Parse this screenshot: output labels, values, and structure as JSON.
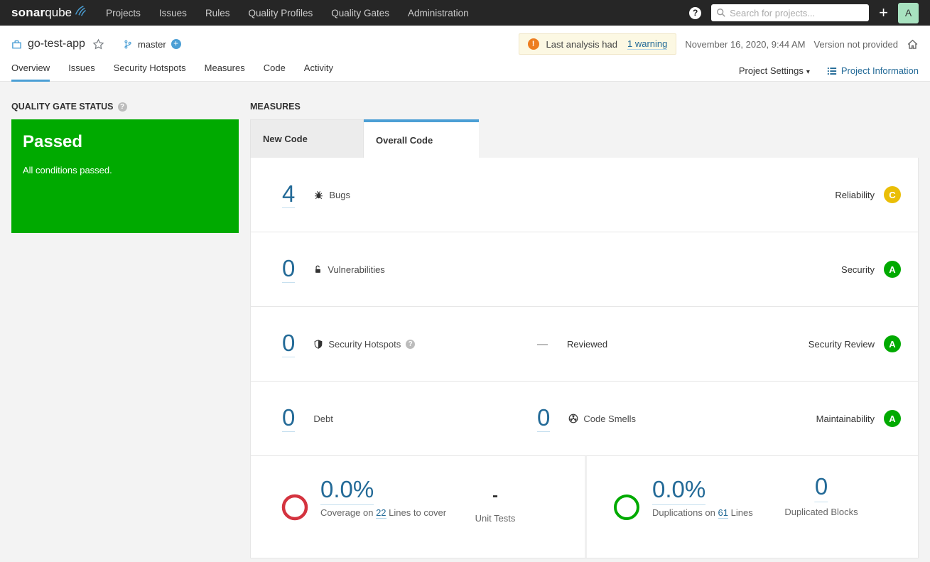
{
  "navbar": {
    "brand_bold": "sonar",
    "brand_light": "qube",
    "items": [
      "Projects",
      "Issues",
      "Rules",
      "Quality Profiles",
      "Quality Gates",
      "Administration"
    ],
    "help": "?",
    "search_placeholder": "Search for projects...",
    "plus": "+",
    "avatar_initial": "A"
  },
  "header": {
    "project_name": "go-test-app",
    "branch_name": "master",
    "branch_add": "+",
    "warning_icon": "!",
    "warning_text": "Last analysis had",
    "warning_link": "1 warning",
    "analysis_date": "November 16, 2020, 9:44 AM",
    "version_text": "Version not provided",
    "tabs": [
      "Overview",
      "Issues",
      "Security Hotspots",
      "Measures",
      "Code",
      "Activity"
    ],
    "settings_label": "Project Settings",
    "settings_caret": "▾",
    "info_label": "Project Information"
  },
  "quality_gate": {
    "title": "QUALITY GATE STATUS",
    "help": "?",
    "status": "Passed",
    "message": "All conditions passed."
  },
  "measures": {
    "title": "MEASURES",
    "tab_new": "New Code",
    "tab_overall": "Overall Code",
    "bugs": {
      "value": "4",
      "label": "Bugs",
      "rating": "C",
      "domain": "Reliability"
    },
    "vulnerabilities": {
      "value": "0",
      "label": "Vulnerabilities",
      "rating": "A",
      "domain": "Security"
    },
    "hotspots": {
      "value": "0",
      "label": "Security Hotspots",
      "help": "?",
      "dash": "—",
      "reviewed_label": "Reviewed",
      "rating": "A",
      "domain": "Security Review"
    },
    "debt": {
      "value": "0",
      "label": "Debt"
    },
    "code_smells": {
      "value": "0",
      "label": "Code Smells",
      "rating": "A",
      "domain": "Maintainability"
    },
    "coverage": {
      "value": "0.0%",
      "caption_prefix": "Coverage on",
      "lines_link": "22",
      "caption_suffix": "Lines to cover",
      "unit_tests_value": "-",
      "unit_tests_label": "Unit Tests"
    },
    "duplications": {
      "value": "0.0%",
      "caption_prefix": "Duplications on",
      "lines_link": "61",
      "caption_suffix": "Lines",
      "blocks_value": "0",
      "blocks_label": "Duplicated Blocks"
    }
  },
  "colors": {
    "green": "#00aa00",
    "yellow": "#eabe06",
    "red_ring": "#d4333f",
    "blue_link": "#236a97",
    "tab_accent": "#4b9fd5",
    "navbar_bg": "#262626",
    "warning_bg": "#fcf8e3",
    "warning_icon": "#ed7d20"
  }
}
